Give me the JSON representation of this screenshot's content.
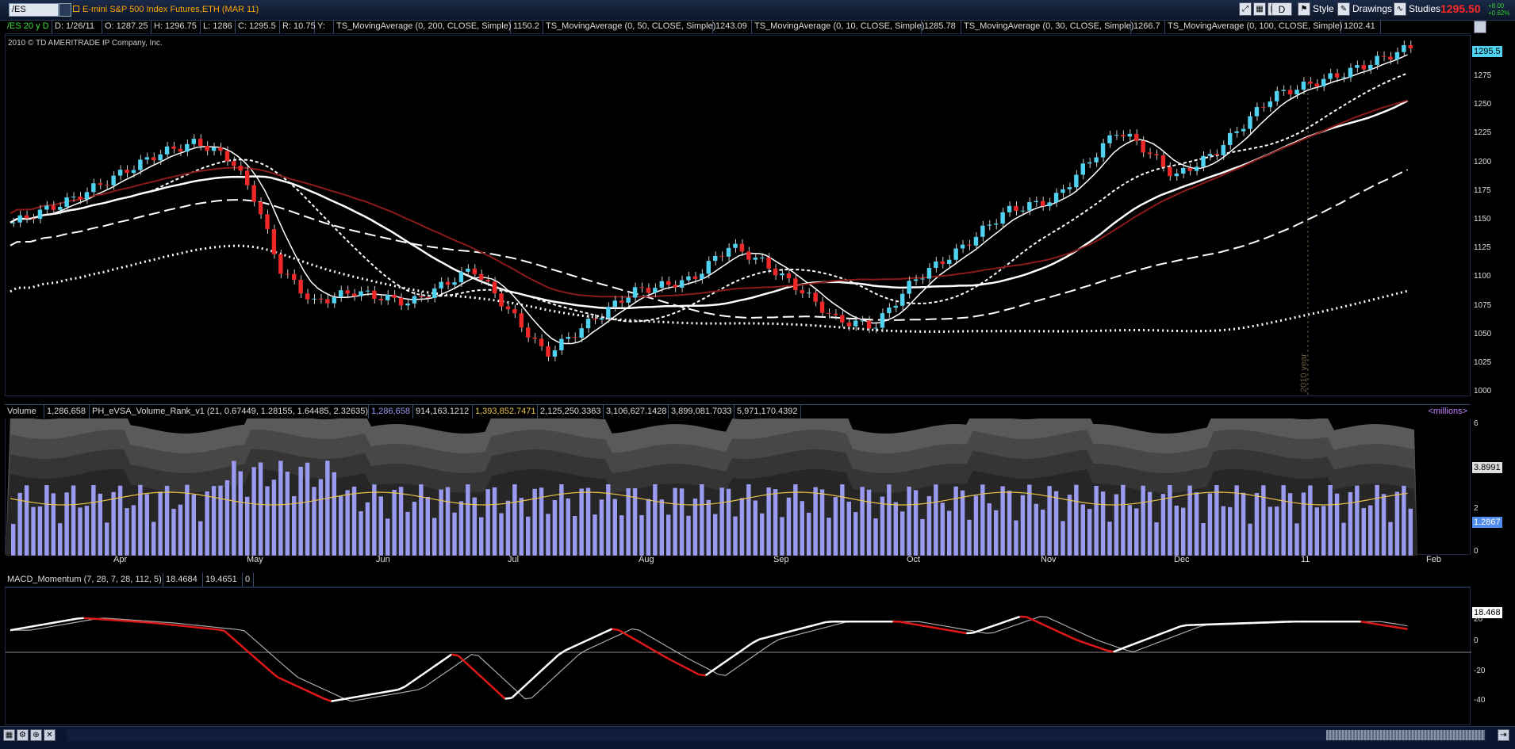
{
  "toolbar": {
    "symbol": "/ES",
    "title": "E-mini S&P 500 Index Futures,ETH (MAR 11)",
    "aggregation": "D",
    "style_label": "Style",
    "drawings_label": "Drawings",
    "studies_label": "Studies",
    "last_price": "1295.50",
    "change_abs": "+8.00",
    "change_pct": "+0.62%"
  },
  "quote": {
    "chart_id": "/ES 20 y D",
    "date": "D: 1/26/11",
    "open": "O: 1287.25",
    "high": "H: 1296.75",
    "low": "L: 1286",
    "close": "C: 1295.5",
    "range": "R: 10.75",
    "y": "Y:",
    "studies": [
      {
        "name": "TS_MovingAverage (0, 200, CLOSE, Simple)",
        "value": "1150.2"
      },
      {
        "name": "TS_MovingAverage (0, 50, CLOSE, Simple)",
        "value": "1243.09"
      },
      {
        "name": "TS_MovingAverage (0, 10, CLOSE, Simple)",
        "value": "1285.78"
      },
      {
        "name": "TS_MovingAverage (0, 30, CLOSE, Simple)",
        "value": "1266.7"
      },
      {
        "name": "TS_MovingAverage (0, 100, CLOSE, Simple)",
        "value": "1202.41"
      }
    ]
  },
  "price_pane": {
    "copyright": "2010 © TD AMERITRADE IP Company, Inc.",
    "last_badge": "1295.5",
    "year_marker": "2010 year",
    "y_ticks": [
      "1275",
      "1250",
      "1225",
      "1200",
      "1175",
      "1150",
      "1125",
      "1100",
      "1075",
      "1050",
      "1025",
      "1000"
    ]
  },
  "volume_pane": {
    "label": "Volume",
    "volume_value": "1,286,658",
    "study": "PH_eVSA_Volume_Rank_v1 (21, 0.67449, 1.28155, 1.64485, 2.32635)",
    "values": [
      "1,286,658",
      "914,163.1212",
      "1,393,852.7471",
      "2,125,250.3363",
      "3,106,627.1428",
      "3,899,081.7033",
      "5,971,170.4392"
    ],
    "units": "<millions>",
    "y_ticks": [
      "6",
      "2",
      "0"
    ],
    "badge_upper": "3.8991",
    "badge_lower": "1.2867"
  },
  "months": [
    "Apr",
    "May",
    "Jun",
    "Jul",
    "Aug",
    "Sep",
    "Oct",
    "Nov",
    "Dec",
    "11",
    "Feb"
  ],
  "macd_pane": {
    "label": "MACD_Momentum (7, 28, 7, 28, 112, 5)",
    "value1": "18.4684",
    "value2": "19.4651",
    "value3": "0",
    "badge": "18.468",
    "y_ticks": [
      "20",
      "0",
      "-20",
      "-40"
    ]
  },
  "colors": {
    "up_candle": "#4fd2f0",
    "down_candle": "#ee2828",
    "ma_white": "#ffffff",
    "ma_red": "#8b1a1a",
    "volume_bar": "#9a9af0",
    "accent_price": "#ff2a2a"
  }
}
